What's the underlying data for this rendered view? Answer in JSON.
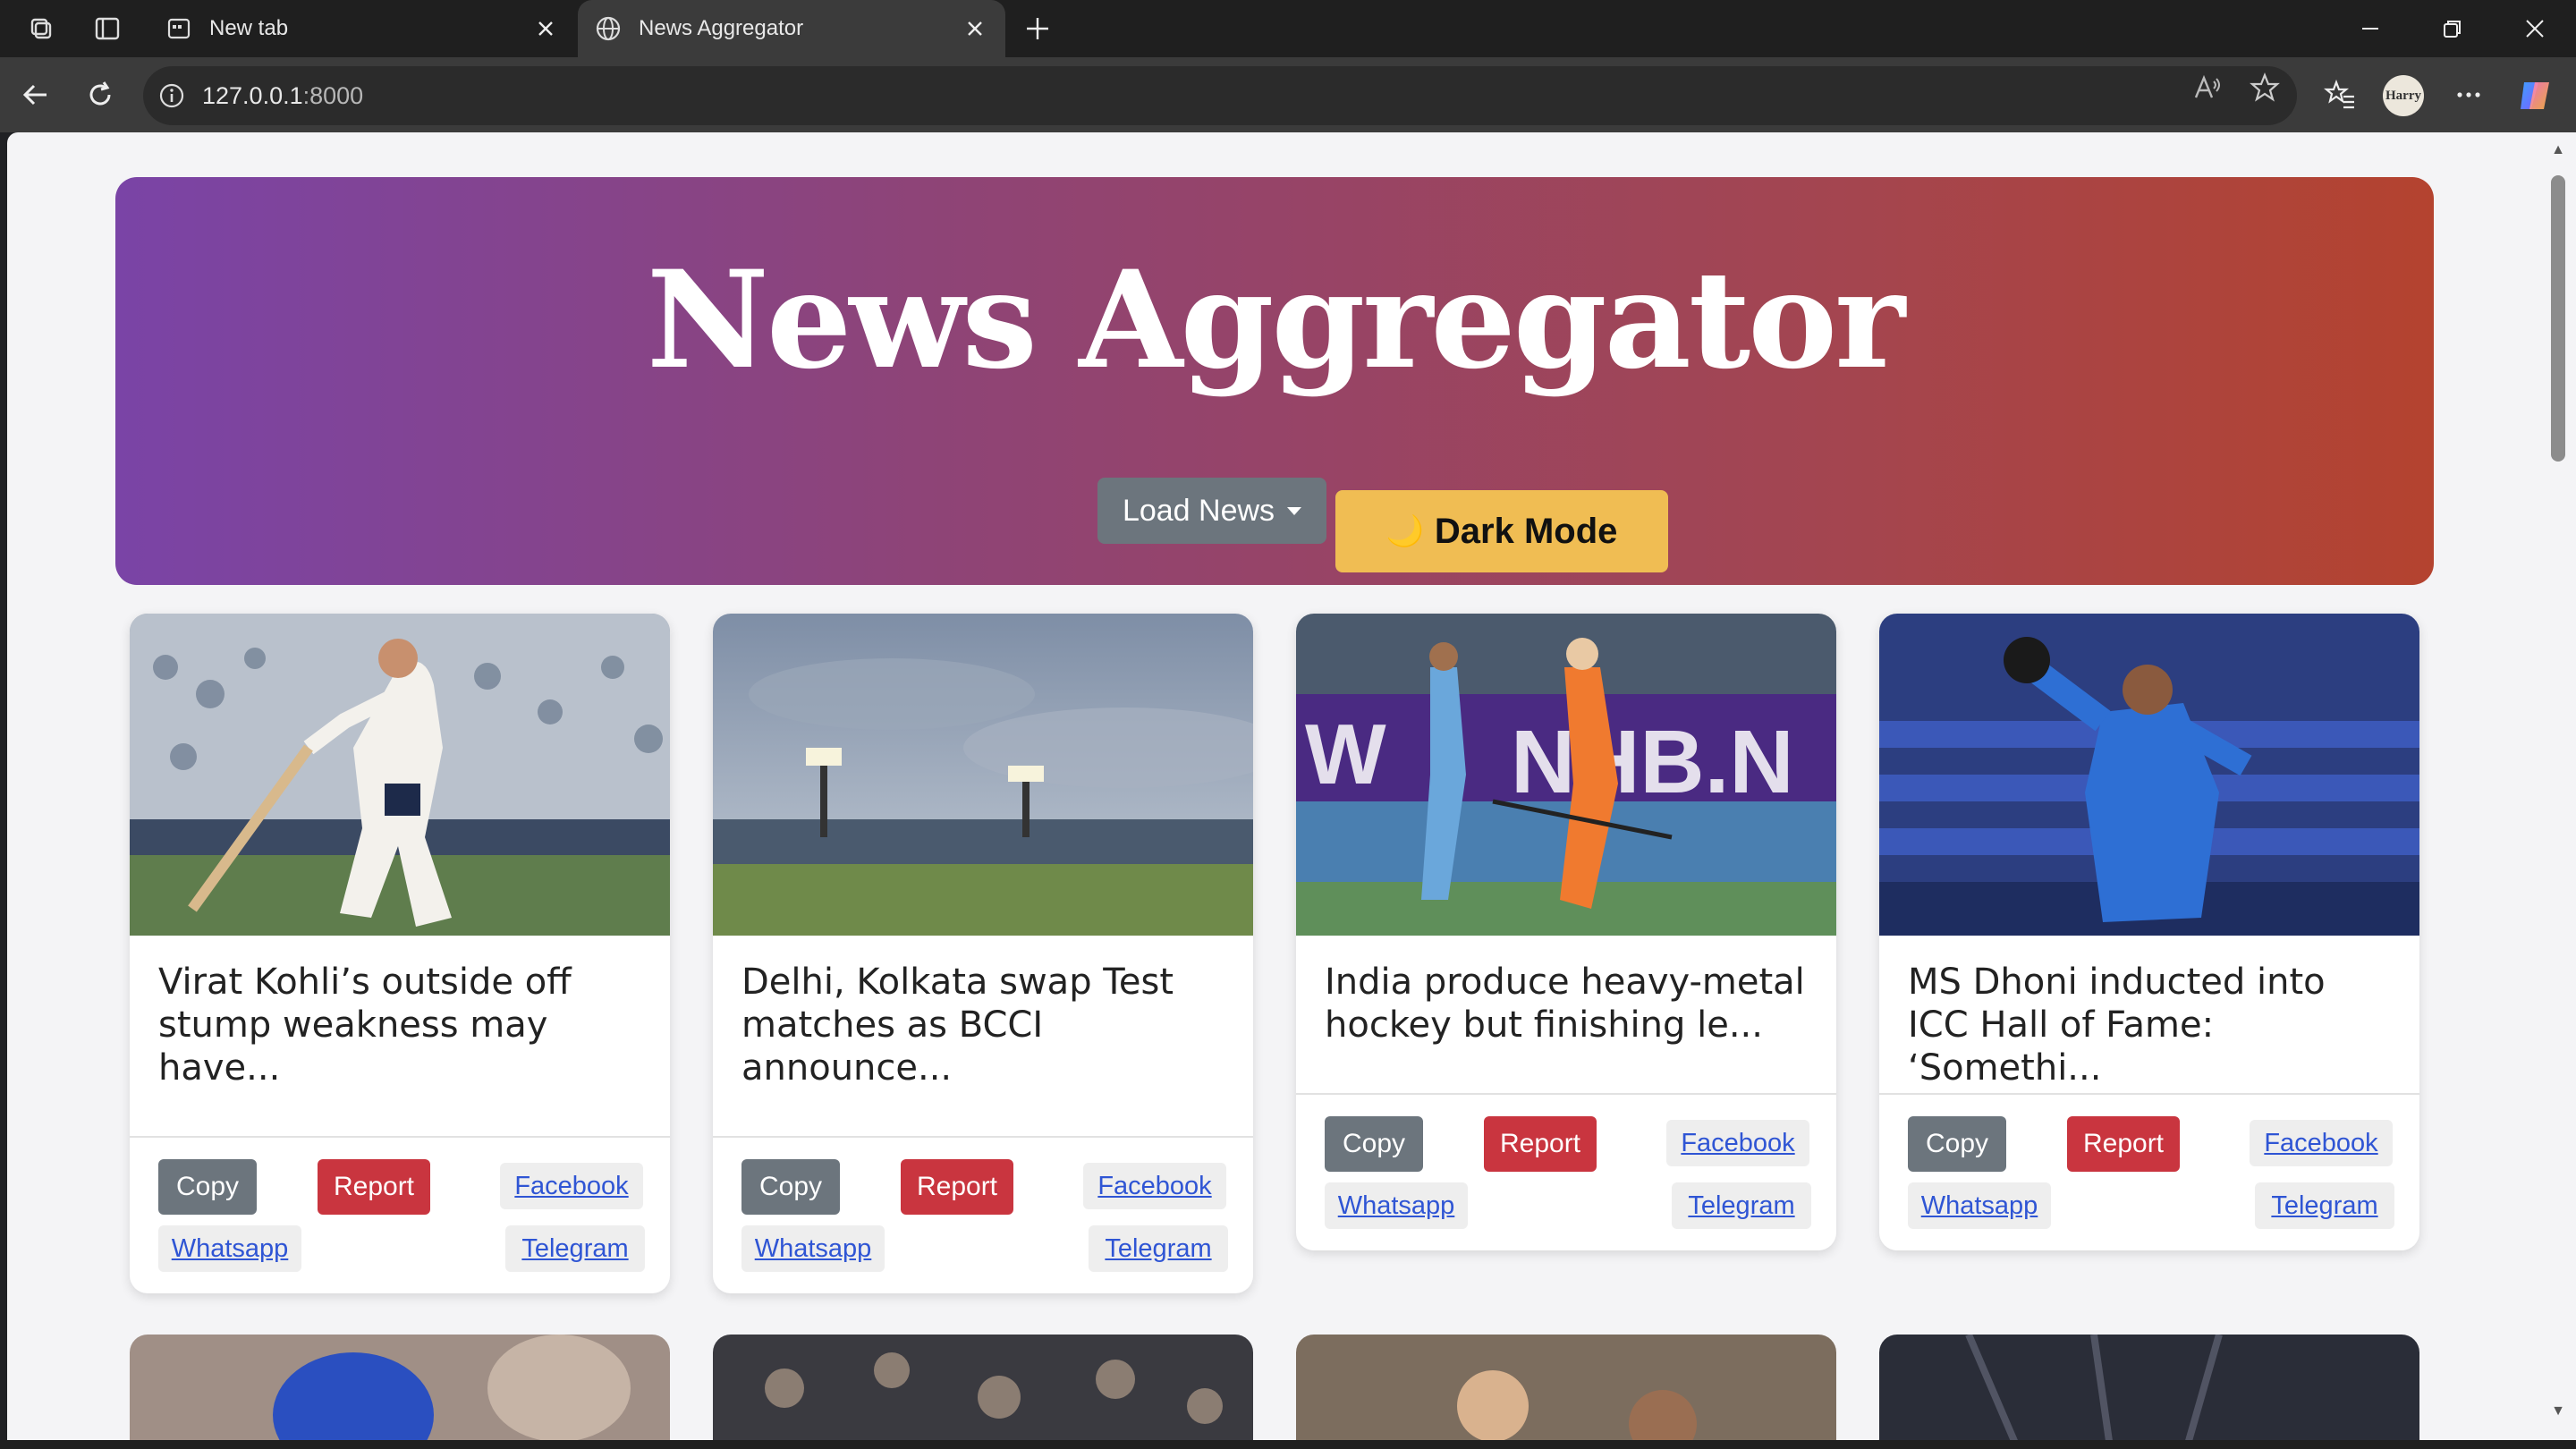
{
  "browser": {
    "tabs": [
      {
        "label": "New tab",
        "active": false
      },
      {
        "label": "News Aggregator",
        "active": true
      }
    ],
    "url_host": "127.0.0.1",
    "url_port": ":8000",
    "profile_label": "Harry"
  },
  "hero": {
    "title": "News Aggregator",
    "load_news_label": "Load News",
    "dark_mode_icon": "🌙",
    "dark_mode_label": "Dark Mode"
  },
  "cards": [
    {
      "title": "Virat Kohli’s outside off stump weakness may have...",
      "image": "cricket-batsman-celebrating"
    },
    {
      "title": "Delhi, Kolkata swap Test matches as BCCI announce...",
      "image": "cricket-stadium-floodlights"
    },
    {
      "title": "India produce heavy-metal hockey but finishing le...",
      "image": "field-hockey-match"
    },
    {
      "title": "MS Dhoni inducted into ICC Hall of Fame: ‘Somethi...",
      "image": "wicketkeeper-celebrating"
    }
  ],
  "card_actions": {
    "copy": "Copy",
    "report": "Report",
    "facebook": "Facebook",
    "whatsapp": "Whatsapp",
    "telegram": "Telegram"
  },
  "colors": {
    "hero_gradient_start": "#7a44a6",
    "hero_gradient_end": "#b4432f",
    "copy_button": "#6c757d",
    "report_button": "#c9353f",
    "dark_mode_button": "#f0bd53",
    "link": "#2f55d4"
  }
}
